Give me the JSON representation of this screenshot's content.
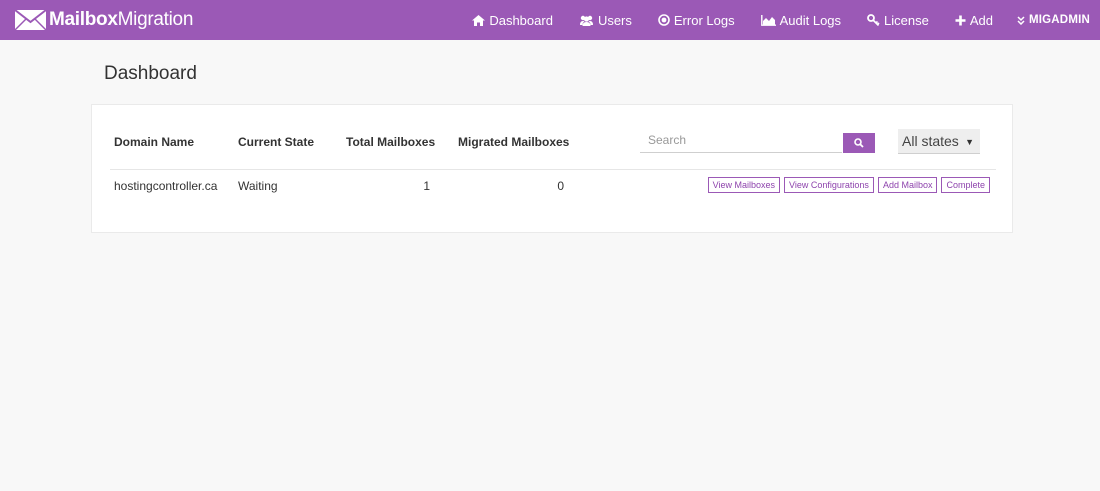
{
  "app": {
    "brand_bold": "Mailbox",
    "brand_regular": "Migration"
  },
  "nav": {
    "items": [
      {
        "label": "Dashboard",
        "icon": "home-icon"
      },
      {
        "label": "Users",
        "icon": "users-icon"
      },
      {
        "label": "Error Logs",
        "icon": "error-circle-icon"
      },
      {
        "label": "Audit Logs",
        "icon": "area-chart-icon"
      },
      {
        "label": "License",
        "icon": "key-icon"
      },
      {
        "label": "Add",
        "icon": "plus-icon"
      },
      {
        "label": "MIGADMIN",
        "icon": "double-chevron-down-icon"
      }
    ]
  },
  "page": {
    "title": "Dashboard"
  },
  "table": {
    "headers": {
      "domain": "Domain Name",
      "state": "Current State",
      "total": "Total Mailboxes",
      "migrated": "Migrated Mailboxes"
    },
    "rows": [
      {
        "domain": "hostingcontroller.ca",
        "state": "Waiting",
        "total": "1",
        "migrated": "0",
        "actions": [
          "View Mailboxes",
          "View Configurations",
          "Add Mailbox",
          "Complete"
        ]
      }
    ]
  },
  "search": {
    "placeholder": "Search",
    "value": ""
  },
  "filter": {
    "selected": "All states"
  },
  "colors": {
    "accent": "#9b59b6",
    "background": "#f8f8f8"
  }
}
